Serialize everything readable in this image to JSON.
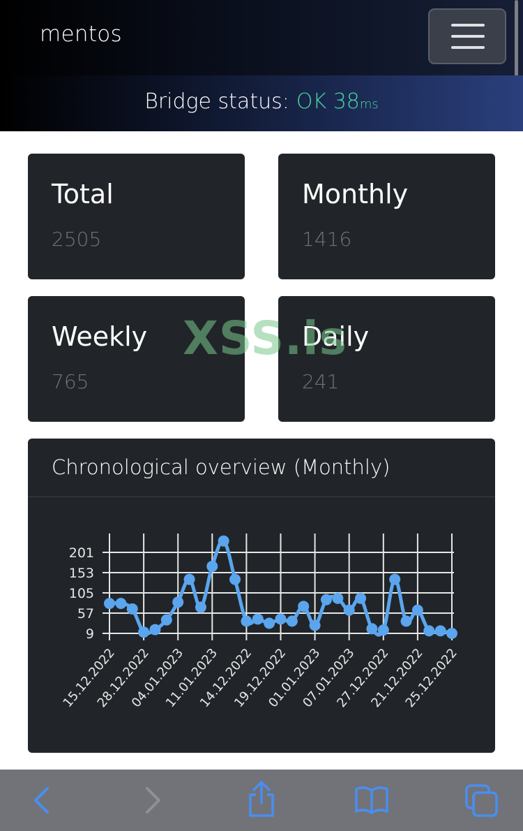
{
  "app": {
    "brand": "mentos",
    "menu_toggle_icon": "hamburger-menu-icon"
  },
  "status": {
    "label": "Bridge status:",
    "state": "OK",
    "latency": "38",
    "unit": "ms",
    "ok_color": "#47d69e"
  },
  "cards": {
    "total": {
      "title": "Total",
      "value": "2505"
    },
    "monthly": {
      "title": "Monthly",
      "value": "1416"
    },
    "weekly": {
      "title": "Weekly",
      "value": "765"
    },
    "daily": {
      "title": "Daily",
      "value": "241"
    }
  },
  "watermark": "XSS.is",
  "chart_card": {
    "title": "Chronological overview (Monthly)"
  },
  "chart_data": {
    "type": "line",
    "series_color": "#5aa5ee",
    "grid": true,
    "y_ticks": [
      "201",
      "153",
      "105",
      "57",
      "9"
    ],
    "ylim": [
      9,
      201
    ],
    "x_tick_labels": [
      "15.12.2022",
      "28.12.2022",
      "04.01.2023",
      "11.01.2023",
      "14.12.2022",
      "19.12.2022",
      "01.01.2023",
      "07.01.2023",
      "27.12.2022",
      "21.12.2022",
      "25.12.2022"
    ],
    "values": [
      80,
      80,
      67,
      12,
      18,
      41,
      83,
      137,
      71,
      168,
      228,
      137,
      38,
      43,
      33,
      43,
      38,
      73,
      28,
      89,
      92,
      64,
      92,
      20,
      17,
      137,
      38,
      64,
      15,
      15,
      9
    ]
  },
  "safari": {
    "back_icon": "back-arrow-icon",
    "forward_icon": "forward-arrow-icon",
    "share_icon": "share-icon",
    "bookmarks_icon": "bookmarks-icon",
    "tabs_icon": "tabs-icon"
  }
}
